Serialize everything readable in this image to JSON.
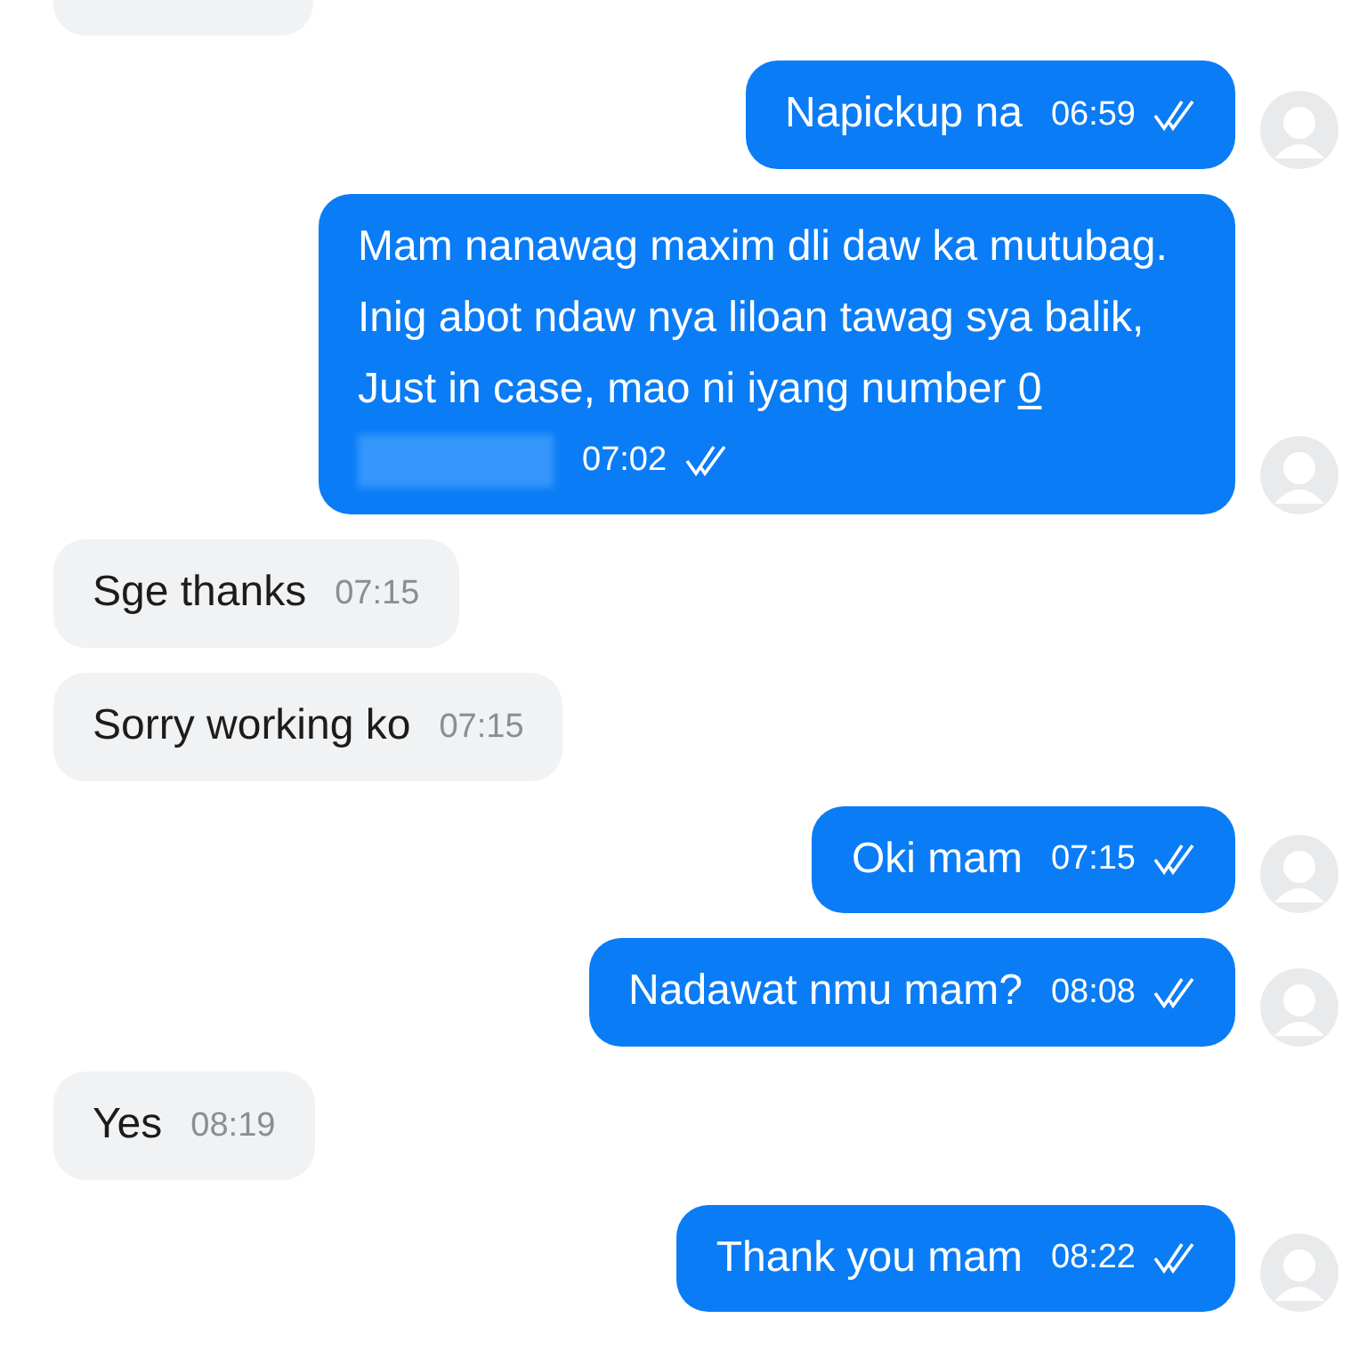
{
  "top_cut_bubble": {
    "kind": "incoming"
  },
  "messages": [
    {
      "kind": "outgoing",
      "text": "Napickup na",
      "time": "06:59"
    },
    {
      "kind": "outgoing",
      "text": "Mam nanawag maxim dli daw ka mutubag. Inig abot ndaw nya liloan tawag sya balik, Just in case, mao ni iyang number",
      "link": "0",
      "redacted": true,
      "time": "07:02"
    },
    {
      "kind": "incoming",
      "text": "Sge thanks",
      "time": "07:15"
    },
    {
      "kind": "incoming",
      "text": "Sorry working ko",
      "time": "07:15"
    },
    {
      "kind": "outgoing",
      "text": "Oki mam",
      "time": "07:15"
    },
    {
      "kind": "outgoing",
      "text": "Nadawat nmu mam?",
      "time": "08:08"
    },
    {
      "kind": "incoming",
      "text": "Yes",
      "time": "08:19"
    },
    {
      "kind": "outgoing",
      "text": "Thank you mam",
      "time": "08:22"
    }
  ]
}
